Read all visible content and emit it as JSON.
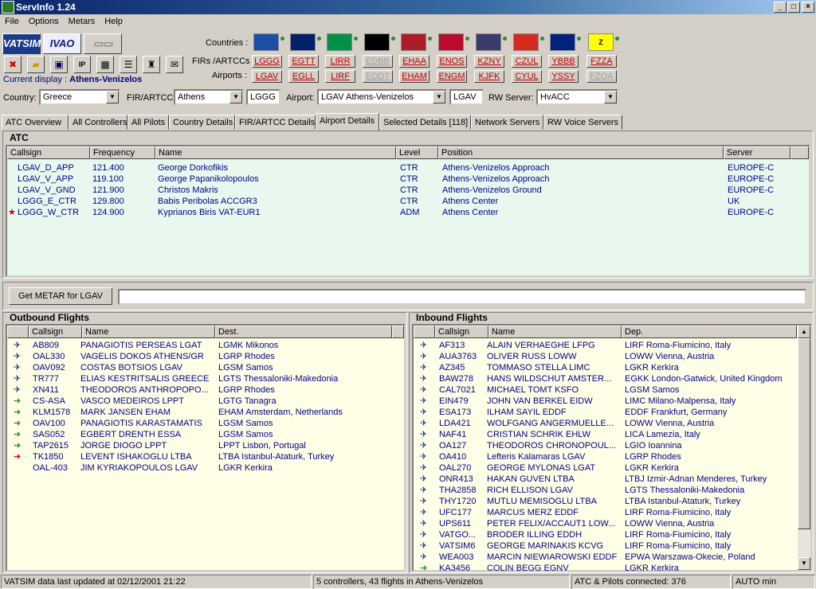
{
  "app": {
    "title": "ServInfo 1.24"
  },
  "menu": [
    "File",
    "Options",
    "Metars",
    "Help"
  ],
  "logos": {
    "vatsim": "VATSIM",
    "ivao": "IVAO"
  },
  "toolbar_icons": [
    "stop-icon",
    "open-folder-icon",
    "save-icon",
    "ip-icon",
    "grid-icon",
    "list-icon",
    "atc-tower-icon",
    "message-icon"
  ],
  "labels": {
    "countries": "Countries :",
    "firs": "FIRs /ARTCCs :",
    "airports": "Airports :",
    "current_display_prefix": "Current display : ",
    "current_display": "Athens-Venizelos",
    "country": "Country:",
    "fir_artcc": "FIR/ARTCC:",
    "airport": "Airport:",
    "rw_server": "RW Server:"
  },
  "flags": [
    {
      "name": "Greece",
      "bg": "#1e4fa8"
    },
    {
      "name": "UK",
      "bg": "#012169"
    },
    {
      "name": "Italy",
      "bg": "#009246"
    },
    {
      "name": "Germany",
      "bg": "#000"
    },
    {
      "name": "Netherlands",
      "bg": "#ae1c28"
    },
    {
      "name": "Norway",
      "bg": "#ba0c2f"
    },
    {
      "name": "USA",
      "bg": "#3c3b6e"
    },
    {
      "name": "Canada",
      "bg": "#d52b1e"
    },
    {
      "name": "Australia",
      "bg": "#00247d"
    },
    {
      "name": "Z",
      "bg": "#ffff00"
    }
  ],
  "firs": [
    "LGGG",
    "EGTT",
    "LIRR",
    "EDBB",
    "EHAA",
    "ENOS",
    "KZNY",
    "CZUL",
    "YBBB",
    "FZZA"
  ],
  "airports": [
    "LGAV",
    "EGLL",
    "LIRF",
    "EDDT",
    "EHAM",
    "ENGM",
    "KJFK",
    "CYUL",
    "YSSY",
    "FZQA"
  ],
  "selectors": {
    "country": "Greece",
    "fir": "Athens",
    "fir_code": "LGGG",
    "airport": "LGAV Athens-Venizelos",
    "airport_code": "LGAV",
    "rw_server": "HvACC"
  },
  "tabs": [
    "ATC Overview",
    "All Controllers",
    "All Pilots",
    "Country Details",
    "FIR/ARTCC Details",
    "Airport Details",
    "Selected Details [118]",
    "Network Servers",
    "RW Voice Servers"
  ],
  "atc": {
    "title": "ATC",
    "headers": [
      "Callsign",
      "Frequency",
      "Name",
      "Level",
      "Position",
      "Server"
    ],
    "rows": [
      [
        "LGAV_D_APP",
        "121.400",
        "George Dorkofikis",
        "CTR",
        "Athens-Venizelos Approach",
        "EUROPE-C"
      ],
      [
        "LGAV_V_APP",
        "119.100",
        "George Papanikolopoulos",
        "CTR",
        "Athens-Venizelos Approach",
        "EUROPE-C"
      ],
      [
        "LGAV_V_GND",
        "121.900",
        "Christos Makris",
        "CTR",
        "Athens-Venizelos Ground",
        "EUROPE-C"
      ],
      [
        "LGGG_E_CTR",
        "129.800",
        "Babis Peribolas ACCGR3",
        "CTR",
        "Athens Center",
        "UK"
      ],
      [
        "LGGG_W_CTR",
        "124.900",
        "Kyprianos Biris VAT-EUR1",
        "ADM",
        "Athens Center",
        "EUROPE-C"
      ]
    ]
  },
  "metar": {
    "button": "Get METAR for LGAV",
    "value": ""
  },
  "outbound": {
    "title": "Outbound Flights",
    "headers": [
      "Callsign",
      "Name",
      "Dest."
    ],
    "rows": [
      [
        "AB809",
        "PANAGIOTIS PERSEAS LGAT",
        "LGMK Mikonos",
        "b"
      ],
      [
        "OAL330",
        "VAGELIS DOKOS ATHENS/GR",
        "LGRP Rhodes",
        "b"
      ],
      [
        "OAV092",
        "COSTAS BOTSIOS LGAV",
        "LGSM Samos",
        "b"
      ],
      [
        "TR777",
        "ELIAS KESTRITSALIS GREECE",
        "LGTS Thessaloniki-Makedonia",
        "b"
      ],
      [
        "XN411",
        "THEODOROS ANTHROPOPO...",
        "LGRP Rhodes",
        "b"
      ],
      [
        "CS-ASA",
        "VASCO MEDEIROS LPPT",
        "LGTG Tanagra",
        "g"
      ],
      [
        "KLM1578",
        "MARK JANSEN EHAM",
        "EHAM Amsterdam, Netherlands",
        "g"
      ],
      [
        "OAV100",
        "PANAGIOTIS KARASTAMATIS",
        "LGSM Samos",
        "g"
      ],
      [
        "SAS052",
        "EGBERT DRENTH ESSA",
        "LGSM Samos",
        "g"
      ],
      [
        "TAP2615",
        "JORGE DIOGO LPPT",
        "LPPT Lisbon, Portugal",
        "g"
      ],
      [
        "TK1850",
        "LEVENT ISHAKOGLU LTBA",
        "LTBA Istanbul-Ataturk, Turkey",
        "r"
      ],
      [
        "OAL-403",
        "JIM KYRIAKOPOULOS LGAV",
        "LGKR Kerkira",
        "n"
      ]
    ]
  },
  "inbound": {
    "title": "Inbound Flights",
    "headers": [
      "Callsign",
      "Name",
      "Dep."
    ],
    "rows": [
      [
        "AF313",
        "ALAIN VERHAEGHE LFPG",
        "LIRF Roma-Fiumicino, Italy",
        "b"
      ],
      [
        "AUA3763",
        "OLIVER RUSS LOWW",
        "LOWW Vienna, Austria",
        "b"
      ],
      [
        "AZ345",
        "TOMMASO STELLA LIMC",
        "LGKR Kerkira",
        "b"
      ],
      [
        "BAW278",
        "HANS WILDSCHUT AMSTER...",
        "EGKK London-Gatwick, United Kingdom",
        "b"
      ],
      [
        "CAL7021",
        "MICHAEL TOMT KSFO",
        "LGSM Samos",
        "b"
      ],
      [
        "EIN479",
        "JOHN VAN BERKEL EIDW",
        "LIMC Milano-Malpensa, Italy",
        "b"
      ],
      [
        "ESA173",
        "ILHAM SAYIL EDDF",
        "EDDF Frankfurt, Germany",
        "b"
      ],
      [
        "LDA421",
        "WOLFGANG ANGERMUELLE...",
        "LOWW Vienna, Austria",
        "b"
      ],
      [
        "NAF41",
        "CRISTIAN SCHRIK EHLW",
        "LICA Lamezia, Italy",
        "b"
      ],
      [
        "OA127",
        "THEODOROS CHRONOPOUL...",
        "LGIO Ioannina",
        "b"
      ],
      [
        "OA410",
        "Lefteris Kalamaras LGAV",
        "LGRP Rhodes",
        "b"
      ],
      [
        "OAL270",
        "GEORGE MYLONAS LGAT",
        "LGKR Kerkira",
        "b"
      ],
      [
        "ONR413",
        "HAKAN GUVEN LTBA",
        "LTBJ Izmir-Adnan Menderes, Turkey",
        "b"
      ],
      [
        "THA2858",
        "RICH ELLISON LGAV",
        "LGTS Thessaloniki-Makedonia",
        "b"
      ],
      [
        "THY1720",
        "MUTLU MEMISOGLU LTBA",
        "LTBA Istanbul-Ataturk, Turkey",
        "b"
      ],
      [
        "UFC177",
        "MARCUS MERZ EDDF",
        "LIRF Roma-Fiumicino, Italy",
        "b"
      ],
      [
        "UPS611",
        "PETER FELIX/ACCAUT1 LOW...",
        "LOWW Vienna, Austria",
        "b"
      ],
      [
        "VATGO...",
        "BRODER ILLING EDDH",
        "LIRF Roma-Fiumicino, Italy",
        "b"
      ],
      [
        "VATSIM6",
        "GEORGE MARINAKIS KCVG",
        "LIRF Roma-Fiumicino, Italy",
        "b"
      ],
      [
        "WEA003",
        "MARCIN NIEWIAROWSKI EDDF",
        "EPWA Warszawa-Okecie, Poland",
        "b"
      ],
      [
        "KA3456",
        "COLIN BEGG EGNV",
        "LGKR Kerkira",
        "g"
      ]
    ]
  },
  "status": [
    "VATSIM data last updated at 02/12/2001 21:22",
    "5 controllers, 43 flights in Athens-Venizelos",
    "ATC & Pilots connected: 376",
    "AUTO min"
  ]
}
